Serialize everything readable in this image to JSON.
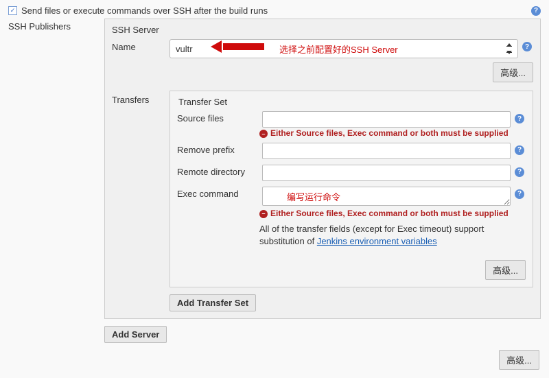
{
  "header": {
    "checkbox_checked": true,
    "title": "Send files or execute commands over SSH after the build runs"
  },
  "section_label": "SSH Publishers",
  "ssh_server": {
    "legend": "SSH Server",
    "name_label": "Name",
    "name_value": "vultr",
    "annotation": "选择之前配置好的SSH Server",
    "advanced_button": "高级..."
  },
  "transfers": {
    "label": "Transfers",
    "set_legend": "Transfer Set",
    "source_files_label": "Source files",
    "source_files_value": "",
    "remove_prefix_label": "Remove prefix",
    "remove_prefix_value": "",
    "remote_dir_label": "Remote directory",
    "remote_dir_value": "",
    "exec_command_label": "Exec command",
    "exec_command_value": "",
    "exec_annotation": "编写运行命令",
    "error_message": "Either Source files, Exec command or both must be supplied",
    "info_text_1": "All of the transfer fields (except for Exec timeout) support substitution of ",
    "info_link": "Jenkins environment variables",
    "advanced_button": "高级...",
    "add_transfer_set": "Add Transfer Set"
  },
  "add_server_button": "Add Server",
  "outer_advanced_button": "高级..."
}
